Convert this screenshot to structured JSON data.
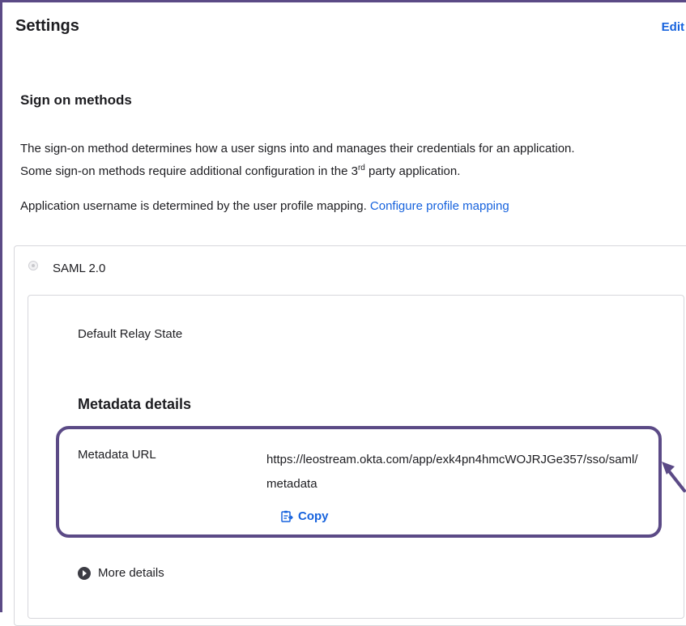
{
  "header": {
    "title": "Settings",
    "edit_label": "Edit"
  },
  "sign_on": {
    "heading": "Sign on methods",
    "description_line1": "The sign-on method determines how a user signs into and manages their credentials for an application.",
    "description_line2_pre": "Some sign-on methods require additional configuration in the 3",
    "description_line2_sup": "rd",
    "description_line2_post": " party application.",
    "username_text": "Application username is determined by the user profile mapping. ",
    "profile_link": "Configure profile mapping"
  },
  "method": {
    "label": "SAML 2.0",
    "default_relay_state_label": "Default Relay State",
    "metadata_heading": "Metadata details",
    "metadata_url_label": "Metadata URL",
    "metadata_url_value": "https://leostream.okta.com/app/exk4pn4hmcWOJRJGe357/sso/saml/metadata",
    "copy_label": "Copy",
    "more_details_label": "More details"
  },
  "colors": {
    "link": "#1662dd",
    "annotation": "#5b4a86"
  },
  "icons": [
    "copy-icon",
    "chevron-right-circle-icon",
    "arrow-annotation-icon",
    "radio-icon"
  ]
}
